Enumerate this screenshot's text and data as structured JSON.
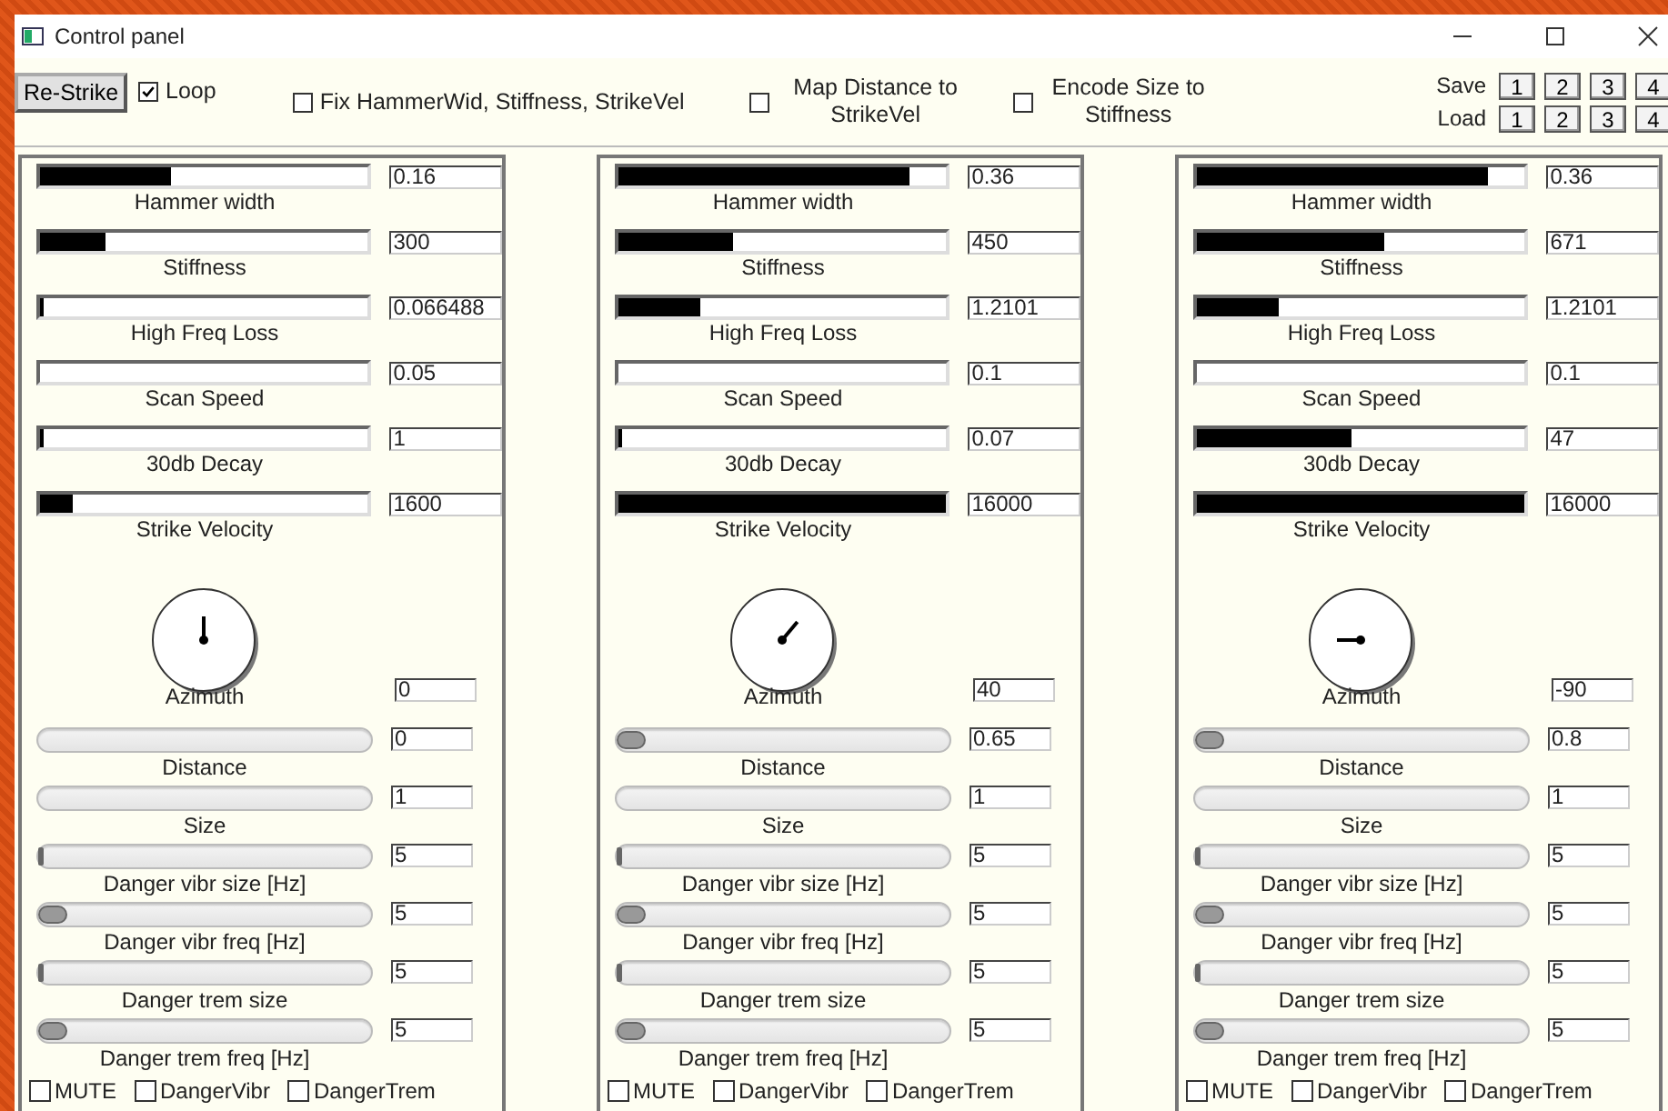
{
  "window": {
    "title": "Control panel"
  },
  "toolbar": {
    "restrike": "Re-Strike",
    "options": [
      {
        "label": "Loop",
        "checked": true,
        "kind": "inline"
      },
      {
        "label": "Fix HammerWid, Stiffness, StrikeVel",
        "checked": false,
        "kind": "inline"
      },
      {
        "label": "Map Distance to StrikeVel",
        "checked": false,
        "kind": "wrapped"
      },
      {
        "label": "Encode Size to Stiffness",
        "checked": false,
        "kind": "wrapped"
      }
    ],
    "presets": [
      {
        "label": "Save",
        "slots": [
          "1",
          "2",
          "3",
          "4"
        ]
      },
      {
        "label": "Load",
        "slots": [
          "1",
          "2",
          "3",
          "4"
        ]
      }
    ]
  },
  "channels": [
    {
      "sliders": [
        {
          "label": "Hammer width",
          "level": 0.4,
          "value": "0.16"
        },
        {
          "label": "Stiffness",
          "level": 0.2,
          "value": "300"
        },
        {
          "label": "High Freq Loss",
          "level": 0.01,
          "value": "0.066488"
        },
        {
          "label": "Scan Speed",
          "value": "0.05"
        },
        {
          "label": "30db Decay",
          "level": 0.01,
          "value": "1"
        },
        {
          "label": "Strike Velocity",
          "level": 0.1,
          "value": "1600"
        }
      ],
      "azimuth": {
        "label": "Azimuth",
        "value": "0"
      },
      "controls": [
        {
          "label": "Distance",
          "kind": "plain",
          "value": "0"
        },
        {
          "label": "Size",
          "kind": "plain",
          "value": "1"
        },
        {
          "label": "Danger vibr size [Hz]",
          "kind": "line",
          "level": 0,
          "value": "5"
        },
        {
          "label": "Danger vibr freq [Hz]",
          "kind": "round",
          "level": 0,
          "value": "5"
        },
        {
          "label": "Danger trem size",
          "kind": "line",
          "level": 0,
          "value": "5"
        },
        {
          "label": "Danger trem freq [Hz]",
          "kind": "round",
          "level": 0,
          "value": "5"
        }
      ],
      "toggles": [
        {
          "label": "MUTE",
          "checked": false
        },
        {
          "label": "DangerVibr",
          "checked": false
        },
        {
          "label": "DangerTrem",
          "checked": false
        }
      ]
    },
    {
      "sliders": [
        {
          "label": "Hammer width",
          "level": 0.89,
          "value": "0.36"
        },
        {
          "label": "Stiffness",
          "level": 0.35,
          "value": "450"
        },
        {
          "label": "High Freq Loss",
          "level": 0.25,
          "value": "1.2101"
        },
        {
          "label": "Scan Speed",
          "value": "0.1"
        },
        {
          "label": "30db Decay",
          "level": 0.01,
          "value": "0.07"
        },
        {
          "label": "Strike Velocity",
          "level": 1,
          "value": "16000"
        }
      ],
      "azimuth": {
        "label": "Azimuth",
        "value": "40"
      },
      "controls": [
        {
          "label": "Distance",
          "kind": "round",
          "level": 0,
          "value": "0.65"
        },
        {
          "label": "Size",
          "kind": "plain",
          "value": "1"
        },
        {
          "label": "Danger vibr size [Hz]",
          "kind": "line",
          "level": 0,
          "value": "5"
        },
        {
          "label": "Danger vibr freq [Hz]",
          "kind": "round",
          "level": 0,
          "value": "5"
        },
        {
          "label": "Danger trem size",
          "kind": "line",
          "level": 0,
          "value": "5"
        },
        {
          "label": "Danger trem freq [Hz]",
          "kind": "round",
          "level": 0,
          "value": "5"
        }
      ],
      "toggles": [
        {
          "label": "MUTE",
          "checked": false
        },
        {
          "label": "DangerVibr",
          "checked": false
        },
        {
          "label": "DangerTrem",
          "checked": false
        }
      ]
    },
    {
      "sliders": [
        {
          "label": "Hammer width",
          "level": 0.89,
          "value": "0.36"
        },
        {
          "label": "Stiffness",
          "level": 0.57,
          "value": "671"
        },
        {
          "label": "High Freq Loss",
          "level": 0.25,
          "value": "1.2101"
        },
        {
          "label": "Scan Speed",
          "value": "0.1"
        },
        {
          "label": "30db Decay",
          "level": 0.47,
          "value": "47"
        },
        {
          "label": "Strike Velocity",
          "level": 1,
          "value": "16000"
        }
      ],
      "azimuth": {
        "label": "Azimuth",
        "value": "-90"
      },
      "controls": [
        {
          "label": "Distance",
          "kind": "round",
          "level": 0,
          "value": "0.8"
        },
        {
          "label": "Size",
          "kind": "plain",
          "value": "1"
        },
        {
          "label": "Danger vibr size [Hz]",
          "kind": "line",
          "level": 0,
          "value": "5"
        },
        {
          "label": "Danger vibr freq [Hz]",
          "kind": "round",
          "level": 0,
          "value": "5"
        },
        {
          "label": "Danger trem size",
          "kind": "line",
          "level": 0,
          "value": "5"
        },
        {
          "label": "Danger trem freq [Hz]",
          "kind": "round",
          "level": 0,
          "value": "5"
        }
      ],
      "toggles": [
        {
          "label": "MUTE",
          "checked": false
        },
        {
          "label": "DangerVibr",
          "checked": false
        },
        {
          "label": "DangerTrem",
          "checked": false
        }
      ]
    }
  ]
}
